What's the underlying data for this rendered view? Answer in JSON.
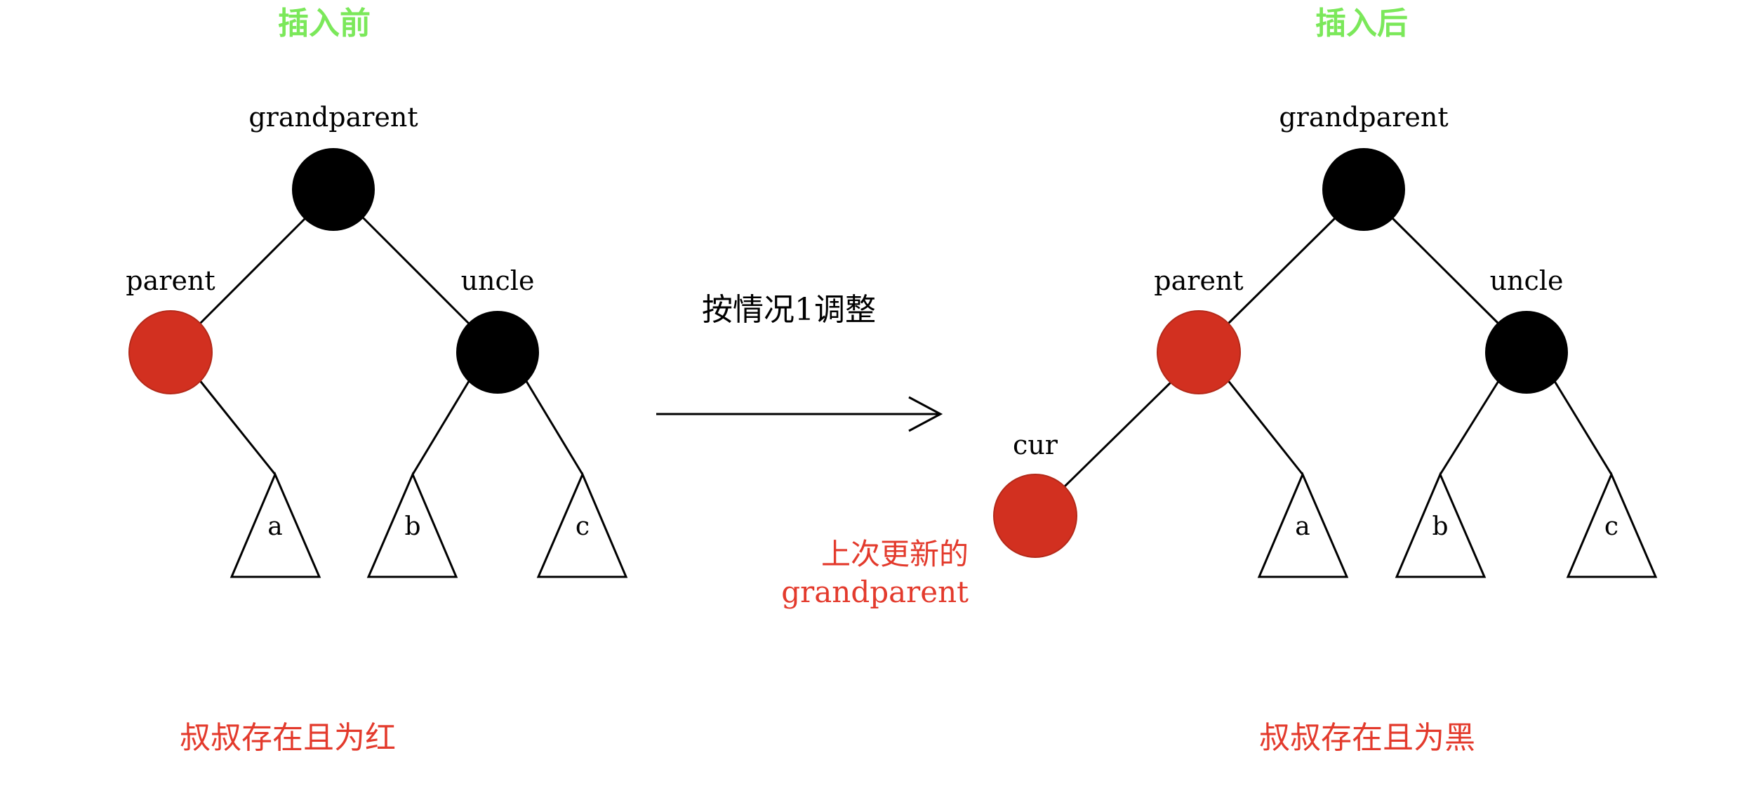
{
  "colors": {
    "red_node": "#d23020",
    "red_node_border": "#b42a1a",
    "black_node": "#000000",
    "title_green": "#7be85a",
    "caption_red": "#e33a2c",
    "edge": "#000000"
  },
  "before": {
    "title": "插入前",
    "grandparent_label": "grandparent",
    "parent_label": "parent",
    "uncle_label": "uncle",
    "leaf_a": "a",
    "leaf_b": "b",
    "leaf_c": "c",
    "caption": "叔叔存在且为红"
  },
  "transition": {
    "label": "按情况1调整"
  },
  "after": {
    "title": "插入后",
    "grandparent_label": "grandparent",
    "parent_label": "parent",
    "uncle_label": "uncle",
    "cur_label": "cur",
    "leaf_a": "a",
    "leaf_b": "b",
    "leaf_c": "c",
    "note_line1": "上次更新的",
    "note_line2": "grandparent",
    "caption": "叔叔存在且为黑"
  }
}
